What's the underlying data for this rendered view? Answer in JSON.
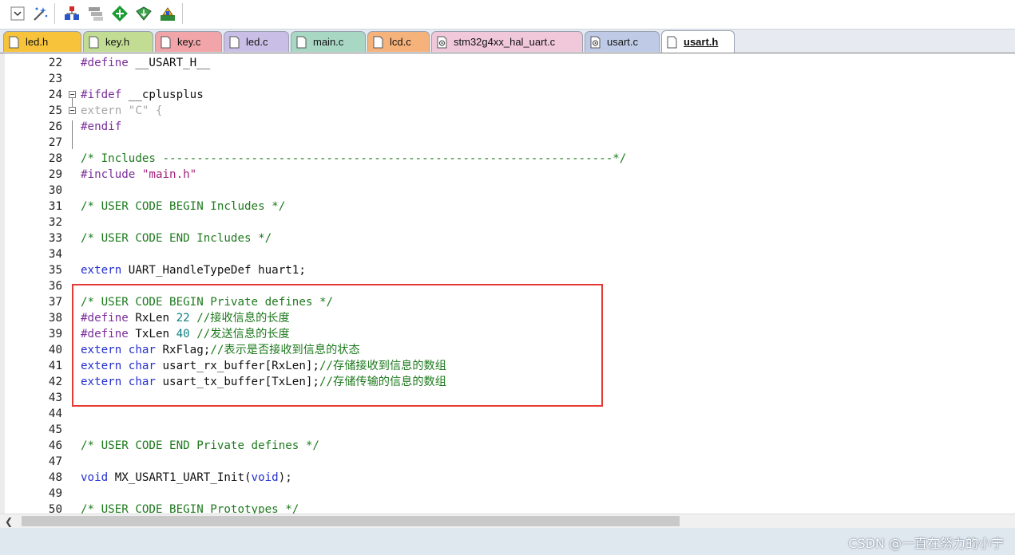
{
  "toolbar": {
    "buttons": [
      {
        "icon": "dropdown-checkbox-icon"
      },
      {
        "icon": "magic-wand-icon"
      },
      {
        "icon": "load-icon"
      },
      {
        "icon": "stack-icon"
      },
      {
        "icon": "green-diamond-icon"
      },
      {
        "icon": "download-icon"
      },
      {
        "icon": "build-icon"
      }
    ]
  },
  "tabs": [
    {
      "label": "led.h",
      "color": "#f6c33b"
    },
    {
      "label": "key.h",
      "color": "#c2dd93"
    },
    {
      "label": "key.c",
      "color": "#f1a5a9"
    },
    {
      "label": "led.c",
      "color": "#c9bfe6"
    },
    {
      "label": "main.c",
      "color": "#a8d7c4"
    },
    {
      "label": "lcd.c",
      "color": "#f6b27b"
    },
    {
      "label": "stm32g4xx_hal_uart.c",
      "color": "#f0c8da"
    },
    {
      "label": "usart.c",
      "color": "#bfcbe6"
    },
    {
      "label": "usart.h",
      "color": "#ffffff"
    }
  ],
  "editor": {
    "lines": [
      {
        "n": "22",
        "tokens": [
          {
            "t": "#define",
            "c": "pp"
          },
          {
            "t": " __USART_H__",
            "c": "tx"
          }
        ]
      },
      {
        "n": "23",
        "tokens": []
      },
      {
        "n": "24",
        "tokens": [
          {
            "t": "#ifdef",
            "c": "pp"
          },
          {
            "t": " __cplusplus",
            "c": "tx"
          }
        ]
      },
      {
        "n": "25",
        "tokens": [
          {
            "t": "extern \"C\" {",
            "c": "gray"
          }
        ]
      },
      {
        "n": "26",
        "tokens": [
          {
            "t": "#endif",
            "c": "pp"
          }
        ]
      },
      {
        "n": "27",
        "tokens": []
      },
      {
        "n": "28",
        "tokens": [
          {
            "t": "/* Includes ------------------------------------------------------------------*/",
            "c": "cm"
          }
        ]
      },
      {
        "n": "29",
        "tokens": [
          {
            "t": "#include",
            "c": "pp"
          },
          {
            "t": " ",
            "c": "tx"
          },
          {
            "t": "\"main.h\"",
            "c": "str"
          }
        ]
      },
      {
        "n": "30",
        "tokens": []
      },
      {
        "n": "31",
        "tokens": [
          {
            "t": "/* USER CODE BEGIN Includes */",
            "c": "cm"
          }
        ]
      },
      {
        "n": "32",
        "tokens": []
      },
      {
        "n": "33",
        "tokens": [
          {
            "t": "/* USER CODE END Includes */",
            "c": "cm"
          }
        ]
      },
      {
        "n": "34",
        "tokens": []
      },
      {
        "n": "35",
        "tokens": [
          {
            "t": "extern",
            "c": "kw"
          },
          {
            "t": " UART_HandleTypeDef huart1;",
            "c": "tx"
          }
        ]
      },
      {
        "n": "36",
        "tokens": []
      },
      {
        "n": "37",
        "tokens": [
          {
            "t": "/* USER CODE BEGIN Private defines */",
            "c": "cm"
          }
        ]
      },
      {
        "n": "38",
        "tokens": [
          {
            "t": "#define",
            "c": "pp"
          },
          {
            "t": " RxLen ",
            "c": "tx"
          },
          {
            "t": "22",
            "c": "num"
          },
          {
            "t": " //接收信息的长度",
            "c": "cm"
          }
        ]
      },
      {
        "n": "39",
        "tokens": [
          {
            "t": "#define",
            "c": "pp"
          },
          {
            "t": " TxLen ",
            "c": "tx"
          },
          {
            "t": "40",
            "c": "num"
          },
          {
            "t": " //发送信息的长度",
            "c": "cm"
          }
        ]
      },
      {
        "n": "40",
        "tokens": [
          {
            "t": "extern",
            "c": "kw"
          },
          {
            "t": " ",
            "c": "tx"
          },
          {
            "t": "char",
            "c": "kw"
          },
          {
            "t": " RxFlag;",
            "c": "tx"
          },
          {
            "t": "//表示是否接收到信息的状态",
            "c": "cm"
          }
        ]
      },
      {
        "n": "41",
        "tokens": [
          {
            "t": "extern",
            "c": "kw"
          },
          {
            "t": " ",
            "c": "tx"
          },
          {
            "t": "char",
            "c": "kw"
          },
          {
            "t": " usart_rx_buffer[RxLen];",
            "c": "tx"
          },
          {
            "t": "//存储接收到信息的数组",
            "c": "cm"
          }
        ]
      },
      {
        "n": "42",
        "tokens": [
          {
            "t": "extern",
            "c": "kw"
          },
          {
            "t": " ",
            "c": "tx"
          },
          {
            "t": "char",
            "c": "kw"
          },
          {
            "t": " usart_tx_buffer[TxLen];",
            "c": "tx"
          },
          {
            "t": "//存储传输的信息的数组",
            "c": "cm"
          }
        ]
      },
      {
        "n": "43",
        "tokens": []
      },
      {
        "n": "44",
        "tokens": []
      },
      {
        "n": "45",
        "tokens": []
      },
      {
        "n": "46",
        "tokens": [
          {
            "t": "/* USER CODE END Private defines */",
            "c": "cm"
          }
        ]
      },
      {
        "n": "47",
        "tokens": []
      },
      {
        "n": "48",
        "tokens": [
          {
            "t": "void",
            "c": "kw"
          },
          {
            "t": " MX_USART1_UART_Init(",
            "c": "tx"
          },
          {
            "t": "void",
            "c": "kw"
          },
          {
            "t": ");",
            "c": "tx"
          }
        ]
      },
      {
        "n": "49",
        "tokens": []
      },
      {
        "n": "50",
        "tokens": [
          {
            "t": "/* USER CODE BEGIN Prototypes */",
            "c": "cm"
          }
        ]
      }
    ]
  },
  "watermark": "CSDN @一直在努力的小宁"
}
